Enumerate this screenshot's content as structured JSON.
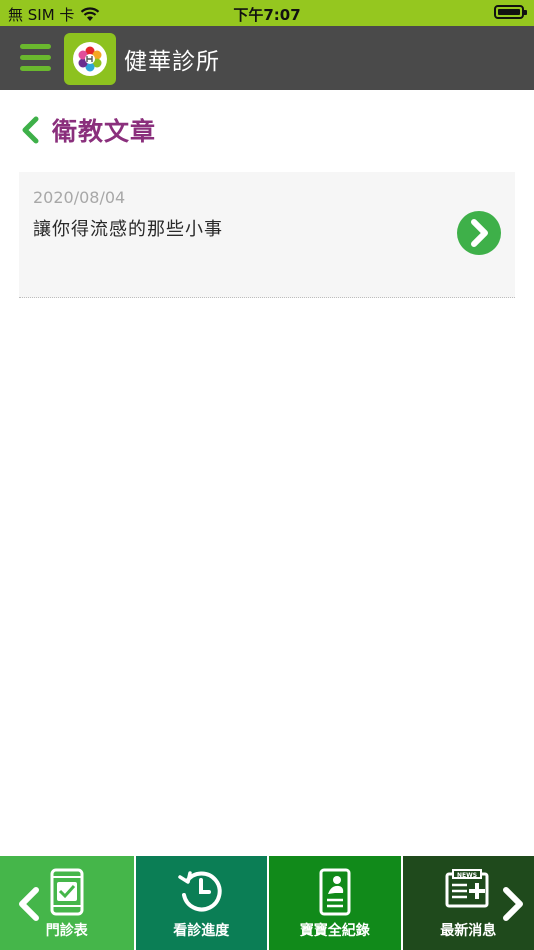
{
  "status_bar": {
    "carrier": "無 SIM 卡",
    "time": "下午7:07"
  },
  "header": {
    "app_title": "健華診所"
  },
  "section": {
    "title": "衛教文章"
  },
  "articles": [
    {
      "date": "2020/08/04",
      "title": "讓你得流感的那些小事"
    }
  ],
  "bottom_nav": [
    {
      "label": "門診表",
      "icon": "phone-check-icon",
      "color": "#45b64a"
    },
    {
      "label": "看診進度",
      "icon": "clock-history-icon",
      "color": "#0b7e55"
    },
    {
      "label": "寶寶全紀錄",
      "icon": "baby-record-icon",
      "color": "#118a1a"
    },
    {
      "label": "最新消息",
      "icon": "news-icon",
      "color": "#1f4a1c"
    }
  ],
  "colors": {
    "status_bar": "#95c71f",
    "header_bg": "#4a4a4a",
    "accent_green": "#3eb049",
    "section_title": "#8a2f7c"
  },
  "icons": {
    "news_badge": "NEWS"
  }
}
